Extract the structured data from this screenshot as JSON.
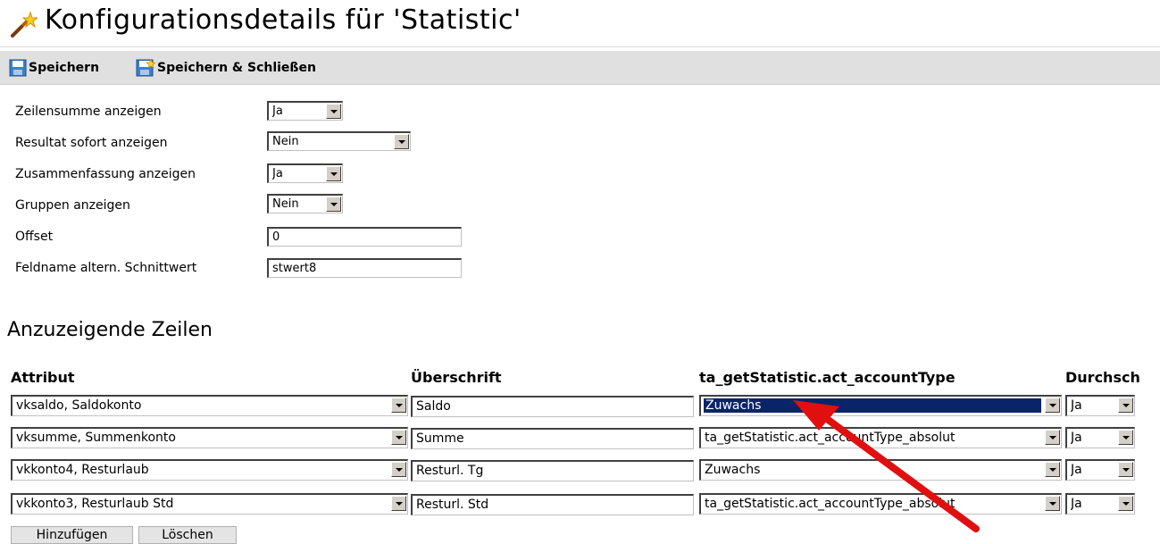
{
  "header": {
    "title": "Konfigurationsdetails für 'Statistic'",
    "icon": "magic-wand-icon"
  },
  "toolbar": {
    "save_label": "Speichern",
    "save_close_label": "Speichern & Schließen",
    "save_icon": "floppy-disk-icon",
    "save_close_icon": "floppy-disk-star-icon"
  },
  "config": [
    {
      "label": "Zeilensumme anzeigen",
      "type": "select",
      "value": "Ja"
    },
    {
      "label": "Resultat sofort anzeigen",
      "type": "select",
      "value": "Nein"
    },
    {
      "label": "Zusammenfassung anzeigen",
      "type": "select",
      "value": "Ja"
    },
    {
      "label": "Gruppen anzeigen",
      "type": "select",
      "value": "Nein"
    },
    {
      "label": "Offset",
      "type": "text",
      "value": "0"
    },
    {
      "label": "Feldname altern. Schnittwert",
      "type": "text",
      "value": "stwert8"
    }
  ],
  "rows_section": {
    "title": "Anzuzeigende Zeilen",
    "columns": [
      "Attribut",
      "Überschrift",
      "ta_getStatistic.act_accountType",
      "Durchsch"
    ],
    "rows": [
      {
        "attribut": "vksaldo, Saldokonto",
        "ueberschrift": "Saldo",
        "account_type": "Zuwachs",
        "durchschnitt": "Ja"
      },
      {
        "attribut": "vksumme, Summenkonto",
        "ueberschrift": "Summe",
        "account_type": "ta_getStatistic.act_accountType_absolut",
        "durchschnitt": "Ja"
      },
      {
        "attribut": "vkkonto4, Resturlaub",
        "ueberschrift": "Resturl. Tg",
        "account_type": "Zuwachs",
        "durchschnitt": "Ja"
      },
      {
        "attribut": "vkkonto3, Resturlaub Std",
        "ueberschrift": "Resturl. Std",
        "account_type": "ta_getStatistic.act_accountType_absolut",
        "durchschnitt": "Ja"
      }
    ]
  },
  "buttons": {
    "add": "Hinzufügen",
    "delete": "Löschen"
  },
  "colors": {
    "toolbar_bg": "#e0e0e0",
    "selection_highlight": "#0a246a",
    "annotation_arrow": "#e01010"
  }
}
